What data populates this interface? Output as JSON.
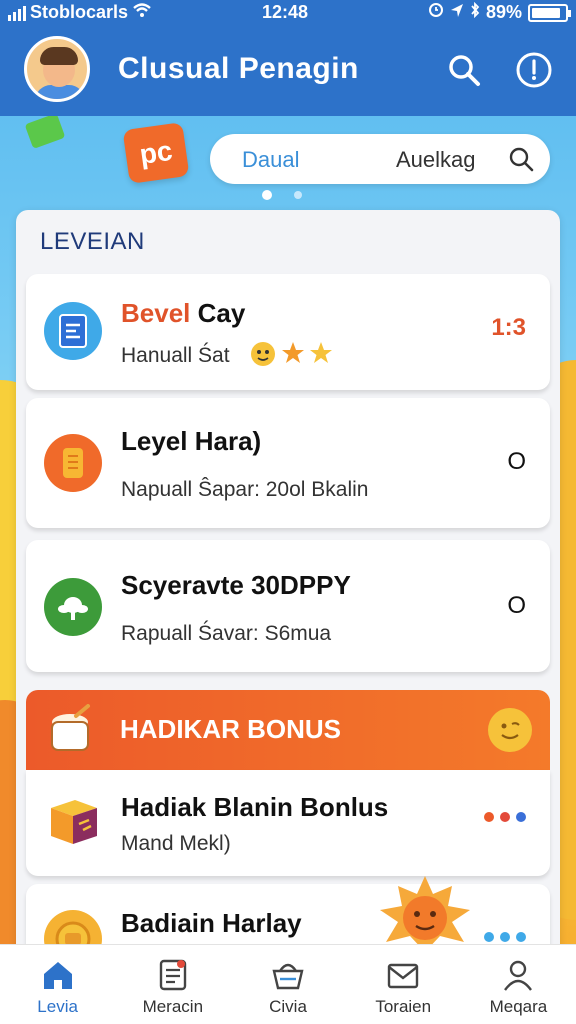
{
  "status_bar": {
    "carrier": "Stoblocarls",
    "time": "12:48",
    "battery": "89%",
    "battery_level": 0.89
  },
  "header": {
    "title": "Clusual Penagin",
    "search_icon": "search-icon",
    "info_icon": "info-icon"
  },
  "promo": {
    "logo_text": "pc",
    "tab_a": "Daual",
    "tab_b": "Auelkag",
    "carousel_pages": 2,
    "carousel_active": 0
  },
  "panel": {
    "title": "LEVEIAN",
    "items": [
      {
        "title_accent": "Bevel",
        "title_rest": " Cay",
        "subtitle": "Hanuall Śat",
        "value": "1:3",
        "icon": "notebook-icon"
      },
      {
        "title": "Leyel Hara)",
        "subtitle": "Napuall Ŝapar: 20ol Bkalin",
        "value": "O",
        "icon": "coin-stack-icon"
      },
      {
        "title": "Scyeravte 30DPPY",
        "subtitle": "Rapuall Śavar: S6mua",
        "value": "O",
        "icon": "leaf-icon"
      }
    ]
  },
  "bonus": {
    "header_title": "HADIKAR BONUS",
    "items": [
      {
        "title": "Hadiak Blanin Bonlus",
        "subtitle": "Mand Mekl)",
        "icon": "gift-box-icon"
      },
      {
        "title": "Badiain Harlay",
        "icon": "coin-icon"
      }
    ]
  },
  "nav": {
    "items": [
      {
        "label": "Levia",
        "icon": "home-icon",
        "active": true
      },
      {
        "label": "Meracin",
        "icon": "document-icon",
        "active": false
      },
      {
        "label": "Civia",
        "icon": "basket-icon",
        "active": false
      },
      {
        "label": "Toraien",
        "icon": "mail-icon",
        "active": false
      },
      {
        "label": "Meqara",
        "icon": "profile-icon",
        "active": false
      }
    ]
  },
  "colors": {
    "header_blue": "#2d72c9",
    "accent_orange": "#ec5a2a",
    "accent_green": "#3d9b3a",
    "accent_sky": "#3fa9e8"
  }
}
